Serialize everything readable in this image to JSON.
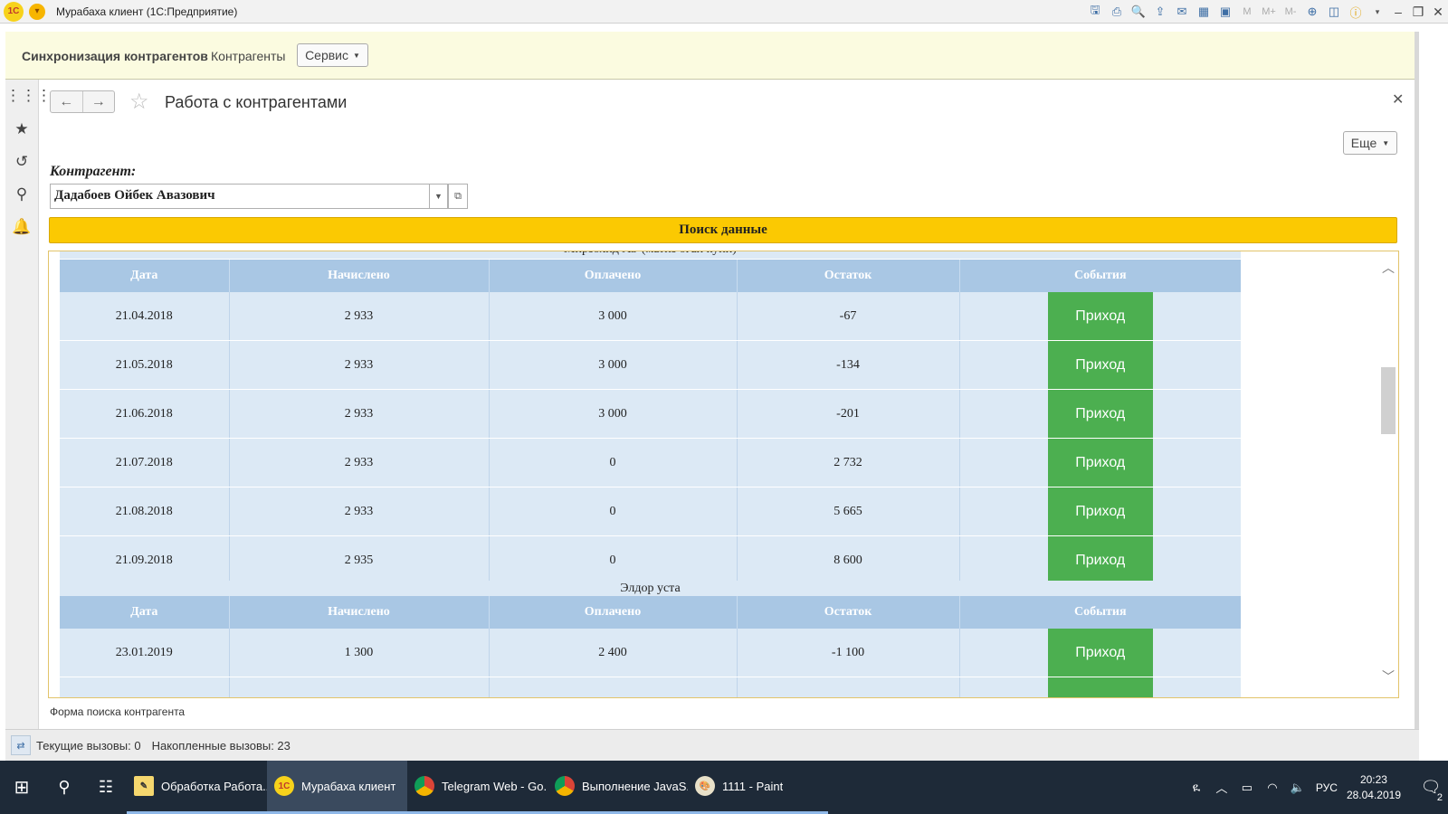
{
  "window": {
    "logo_text": "1С",
    "title": "Мурабаха клиент  (1С:Предприятие)",
    "toolbar_m_labels": [
      "M",
      "M+",
      "M-"
    ]
  },
  "menubar": {
    "items": [
      "Синхронизация контрагентов",
      "Контрагенты",
      "Сервис"
    ]
  },
  "form": {
    "title": "Работа с контрагентами",
    "more_label": "Еще",
    "contragent_label": "Контрагент:",
    "contragent_value": "Дадабоев Ойбек Авазович",
    "search_label": "Поиск данные",
    "footer_note": "Форма поиска контрагента"
  },
  "results": {
    "columns": [
      "Дата",
      "Начислено",
      "Оплачено",
      "Остаток",
      "События"
    ],
    "event_label": "Приход",
    "groups": [
      {
        "title": "Мирзохид АЗ-(матиз оган куни)",
        "rows": [
          [
            "21.04.2018",
            "2 933",
            "3 000",
            "-67"
          ],
          [
            "21.05.2018",
            "2 933",
            "3 000",
            "-134"
          ],
          [
            "21.06.2018",
            "2 933",
            "3 000",
            "-201"
          ],
          [
            "21.07.2018",
            "2 933",
            "0",
            "2 732"
          ],
          [
            "21.08.2018",
            "2 933",
            "0",
            "5 665"
          ],
          [
            "21.09.2018",
            "2 935",
            "0",
            "8 600"
          ]
        ]
      },
      {
        "title": "Элдор уста",
        "rows": [
          [
            "23.01.2019",
            "1 300",
            "2 400",
            "-1 100"
          ],
          [
            "",
            "",
            "",
            ""
          ]
        ]
      }
    ]
  },
  "statusbar": {
    "current_calls": "Текущие вызовы: 0",
    "accumulated_calls": "Накопленные вызовы: 23"
  },
  "taskbar": {
    "apps": [
      {
        "label": "Обработка Работа...",
        "icon": "paint-icon",
        "state": "open"
      },
      {
        "label": "Мурабаха клиент",
        "icon": "1c-icon",
        "state": "active"
      },
      {
        "label": "Telegram Web - Go...",
        "icon": "chrome-icon",
        "state": "open"
      },
      {
        "label": "Выполнение JavaS...",
        "icon": "chrome-icon",
        "state": "open"
      },
      {
        "label": "1111 - Paint",
        "icon": "paint-icon",
        "state": "open"
      }
    ],
    "language": "РУС",
    "time": "20:23",
    "date": "28.04.2019",
    "notifications": "2"
  }
}
